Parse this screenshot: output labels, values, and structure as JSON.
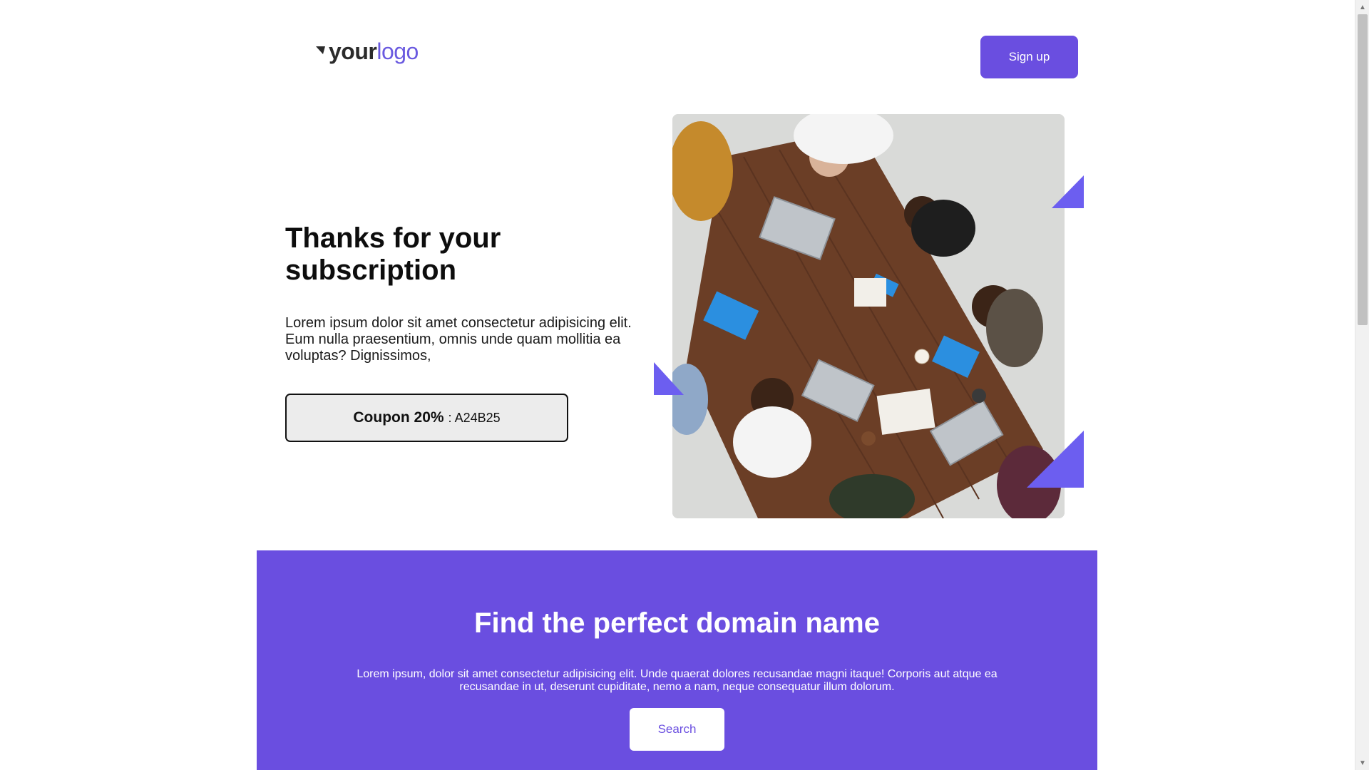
{
  "header": {
    "logo": {
      "part1": "your",
      "part2": "logo"
    },
    "signup_label": "Sign up"
  },
  "hero": {
    "title": "Thanks for your subscription",
    "text": "Lorem ipsum dolor sit amet consectetur adipisicing elit. Eum nulla praesentium, omnis unde quam mollitia ea voluptas? Dignissimos,",
    "coupon": {
      "label": "Coupon 20%",
      "separator": ":",
      "code": "A24B25"
    },
    "image_alt": "team-meeting-photo"
  },
  "domain": {
    "title": "Find the perfect domain name",
    "text": "Lorem ipsum, dolor sit amet consectetur adipisicing elit. Unde quaerat dolores recusandae magni itaque! Corporis aut atque ea recusandae in ut, deserunt cupiditate, nemo a nam, neque consequatur illum dolorum.",
    "search_label": "Search"
  },
  "colors": {
    "accent": "#6a4ee0",
    "triangle": "#6c5ef0"
  }
}
